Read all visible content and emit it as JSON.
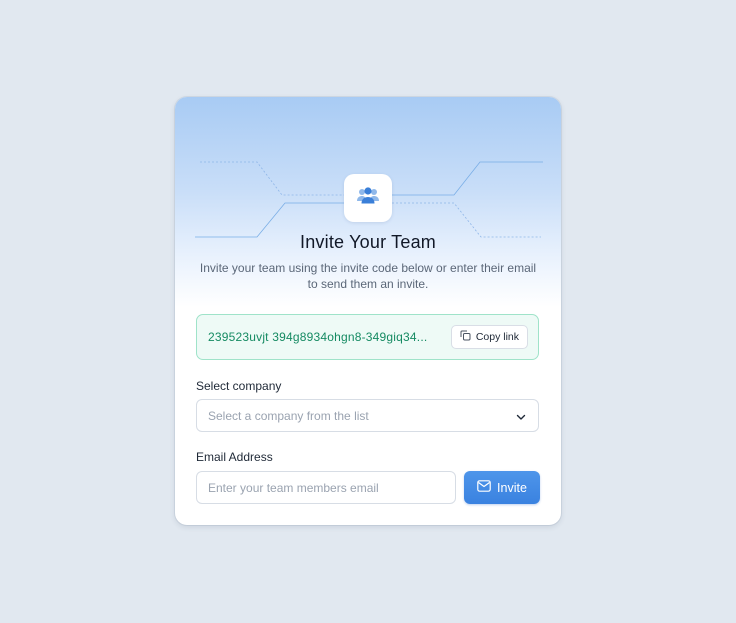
{
  "header": {
    "icon": "users-icon",
    "title": "Invite Your Team",
    "subtitle": "Invite your team using the invite code below or enter their email to send them an invite."
  },
  "invite_code": {
    "value": "239523uvjt 394g8934ohgn8-349giq34...",
    "copy_label": "Copy link",
    "copy_icon": "copy-icon"
  },
  "company": {
    "label": "Select company",
    "placeholder": "Select a company from the list",
    "chevron_icon": "chevron-down-icon"
  },
  "email": {
    "label": "Email Address",
    "placeholder": "Enter your team members email",
    "value": ""
  },
  "invite_button": {
    "label": "Invite",
    "icon": "mail-icon"
  },
  "colors": {
    "accent": "#3a82e0",
    "code_text": "#158a62",
    "code_bg": "#eefaf6",
    "page_bg": "#e1e8f0"
  }
}
